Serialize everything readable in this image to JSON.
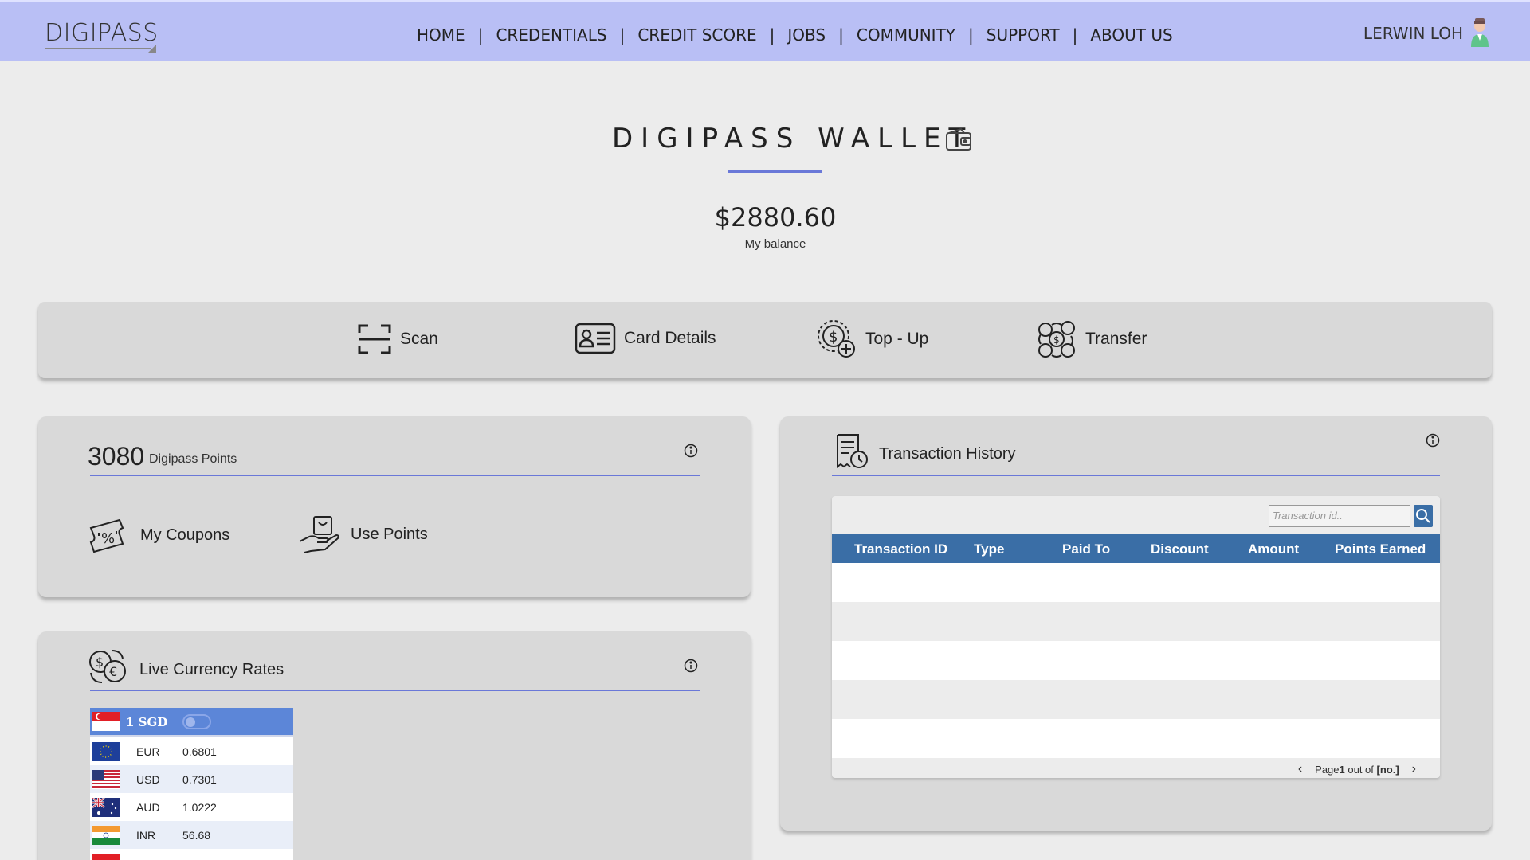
{
  "header": {
    "logo": "DIGIPASS",
    "nav": [
      "HOME",
      "CREDENTIALS",
      "CREDIT SCORE",
      "JOBS",
      "COMMUNITY",
      "SUPPORT",
      "ABOUT US"
    ],
    "nav_separator": "|",
    "user_name": "LERWIN LOH"
  },
  "wallet": {
    "title": "DIGIPASS WALLET",
    "balance": "$2880.60",
    "balance_label": "My balance"
  },
  "actions": {
    "scan": "Scan",
    "card_details": "Card Details",
    "top_up": "Top - Up",
    "transfer": "Transfer"
  },
  "points": {
    "value": "3080",
    "label": "Digipass Points",
    "my_coupons": "My Coupons",
    "use_points": "Use Points"
  },
  "history": {
    "title": "Transaction History",
    "search_placeholder": "Transaction id..",
    "columns": [
      "Transaction ID",
      "Type",
      "Paid To",
      "Discount",
      "Amount",
      "Points Earned"
    ],
    "pager_prefix": "Page ",
    "pager_page": "1",
    "pager_mid": " out of ",
    "pager_total": "[no.]"
  },
  "currency": {
    "title": "Live Currency Rates",
    "base": "1 SGD",
    "rates": [
      {
        "code": "EUR",
        "value": "0.6801"
      },
      {
        "code": "USD",
        "value": "0.7301"
      },
      {
        "code": "AUD",
        "value": "1.0222"
      },
      {
        "code": "INR",
        "value": "56.68"
      }
    ]
  },
  "colors": {
    "topbar": "#b9bff5",
    "accent_line": "#6a78d8",
    "table_header": "#3a6ea6",
    "currency_header": "#5c86d8",
    "panel": "#d9d9d9",
    "page": "#ececec"
  }
}
